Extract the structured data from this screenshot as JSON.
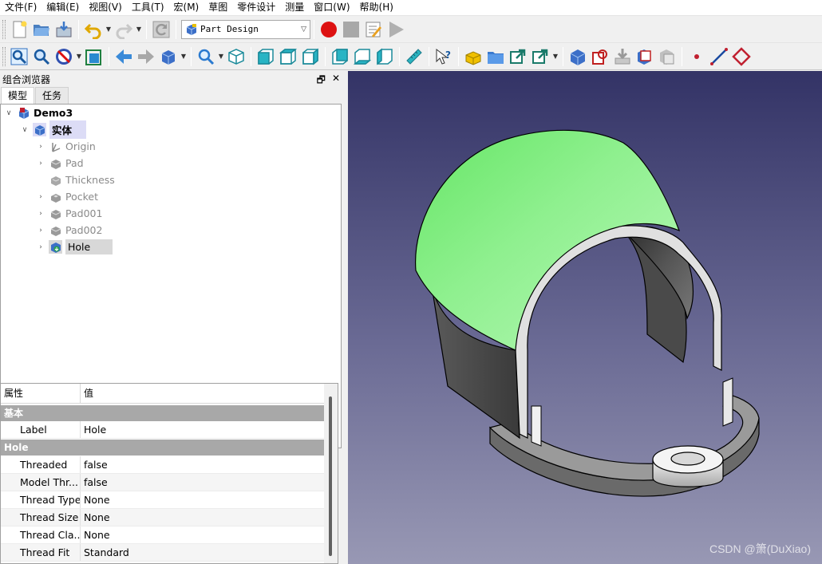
{
  "menubar": {
    "items": [
      "文件(F)",
      "编辑(E)",
      "视图(V)",
      "工具(T)",
      "宏(M)",
      "草图",
      "零件设计",
      "测量",
      "窗口(W)",
      "帮助(H)"
    ]
  },
  "toolbar": {
    "workbench_label": "Part Design"
  },
  "combo": {
    "title": "组合浏览器",
    "float_glyph": "🗗",
    "close_glyph": "✕",
    "tabs": [
      "模型",
      "任务"
    ]
  },
  "tree": {
    "document": "Demo3",
    "body": "实体",
    "items": [
      "Origin",
      "Pad",
      "Thickness",
      "Pocket",
      "Pad001",
      "Pad002",
      "Hole"
    ]
  },
  "properties": {
    "col_property": "属性",
    "col_value": "值",
    "group_base": "基本",
    "label_name": "Label",
    "label_value": "Hole",
    "group_hole": "Hole",
    "rows": [
      {
        "name": "Threaded",
        "value": "false"
      },
      {
        "name": "Model Thr...",
        "value": "false"
      },
      {
        "name": "Thread Type",
        "value": "None"
      },
      {
        "name": "Thread Size",
        "value": "None"
      },
      {
        "name": "Thread Cla...",
        "value": "None"
      },
      {
        "name": "Thread Fit",
        "value": "Standard"
      }
    ]
  },
  "viewport": {
    "watermark": "CSDN @箫(DuXiao)",
    "selected_face_color": "#80ee80"
  }
}
